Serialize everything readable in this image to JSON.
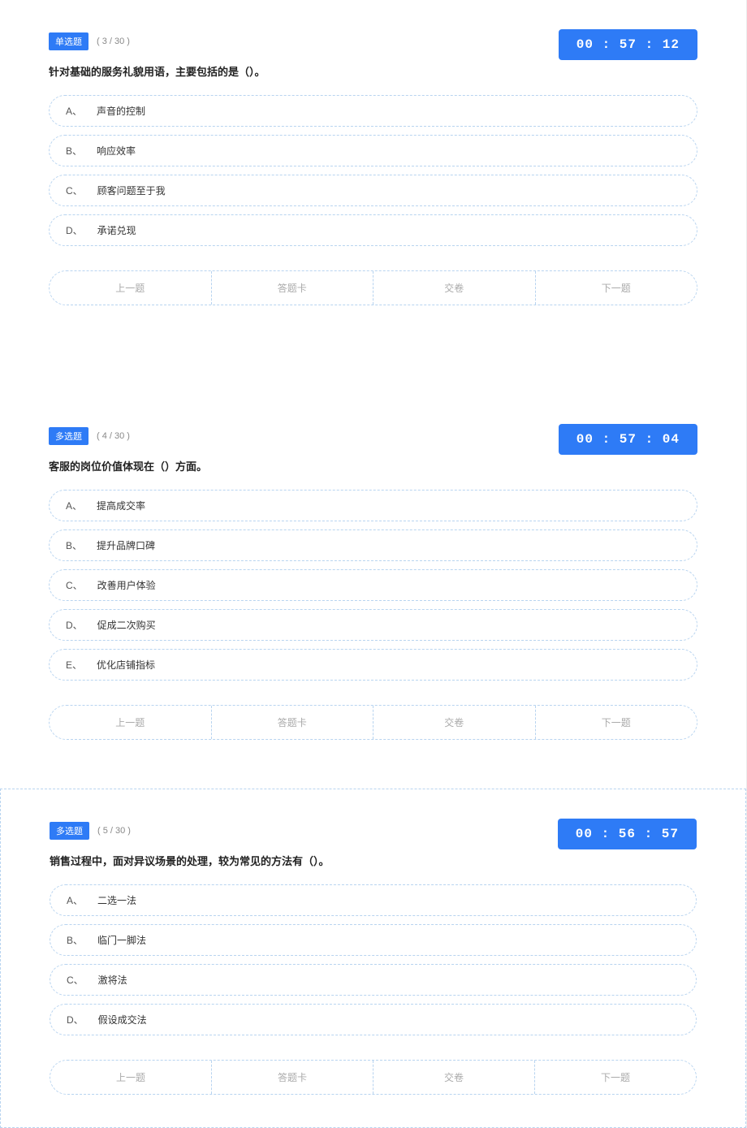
{
  "questions": [
    {
      "type_label": "单选题",
      "progress": "( 3 / 30 )",
      "timer": "00 : 57 : 12",
      "prompt": "针对基础的服务礼貌用语，主要包括的是（）。",
      "options": [
        {
          "letter": "A、",
          "text": "声音的控制"
        },
        {
          "letter": "B、",
          "text": "响应效率"
        },
        {
          "letter": "C、",
          "text": "顾客问题至于我"
        },
        {
          "letter": "D、",
          "text": "承诺兑现"
        }
      ]
    },
    {
      "type_label": "多选题",
      "progress": "( 4 / 30 )",
      "timer": "00 : 57 : 04",
      "prompt": "客服的岗位价值体现在（）方面。",
      "options": [
        {
          "letter": "A、",
          "text": "提高成交率"
        },
        {
          "letter": "B、",
          "text": "提升品牌口碑"
        },
        {
          "letter": "C、",
          "text": "改善用户体验"
        },
        {
          "letter": "D、",
          "text": "促成二次购买"
        },
        {
          "letter": "E、",
          "text": "优化店铺指标"
        }
      ]
    },
    {
      "type_label": "多选题",
      "progress": "( 5 / 30 )",
      "timer": "00 : 56 : 57",
      "prompt": "销售过程中，面对异议场景的处理，较为常见的方法有（）。",
      "options": [
        {
          "letter": "A、",
          "text": "二选一法"
        },
        {
          "letter": "B、",
          "text": "临门一脚法"
        },
        {
          "letter": "C、",
          "text": "激将法"
        },
        {
          "letter": "D、",
          "text": "假设成交法"
        }
      ]
    }
  ],
  "nav": {
    "prev": "上一题",
    "card": "答题卡",
    "submit": "交卷",
    "next": "下一题"
  }
}
